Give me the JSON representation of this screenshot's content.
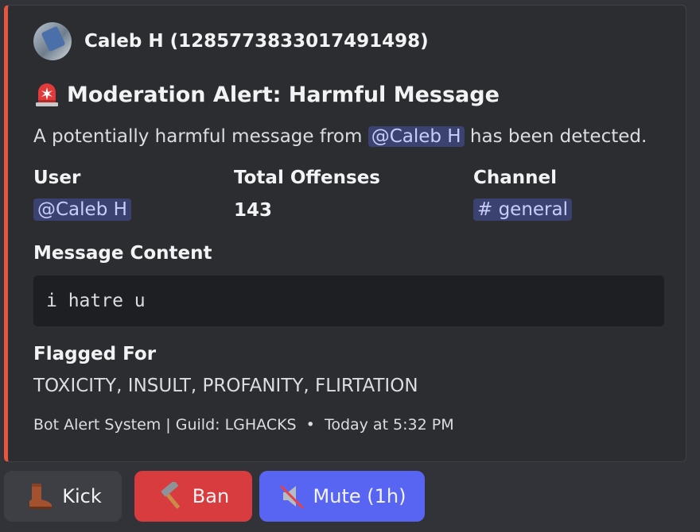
{
  "author": {
    "name": "Caleb H (1285773833017491498)"
  },
  "title": {
    "icon": "siren-icon",
    "text": "Moderation Alert: Harmful Message"
  },
  "description": {
    "prefix": "A potentially harmful message from",
    "mention": "@Caleb H",
    "suffix": "has been detected."
  },
  "fields": {
    "user": {
      "name": "User",
      "value": "@Caleb H"
    },
    "offenses": {
      "name": "Total Offenses",
      "value": "143"
    },
    "channel": {
      "name": "Channel",
      "value": "# general"
    },
    "message": {
      "name": "Message Content",
      "value": "i hatre u"
    },
    "flagged": {
      "name": "Flagged For",
      "value": "TOXICITY, INSULT, PROFANITY, FLIRTATION"
    }
  },
  "footer": {
    "text": "Bot Alert System | Guild: LGHACKS",
    "timestamp": "Today at 5:32 PM",
    "separator": "•"
  },
  "buttons": {
    "kick": {
      "label": "Kick",
      "icon": "boot-icon"
    },
    "ban": {
      "label": "Ban",
      "icon": "hammer-icon"
    },
    "mute": {
      "label": "Mute (1h)",
      "icon": "muted-speaker-icon"
    }
  },
  "colors": {
    "accent_bar": "#e5563e",
    "ban": "#d83c3e",
    "mute": "#5865f2",
    "kick": "#3d3f45",
    "mention_bg": "#3c4270",
    "mention_text": "#c9cdfb"
  }
}
